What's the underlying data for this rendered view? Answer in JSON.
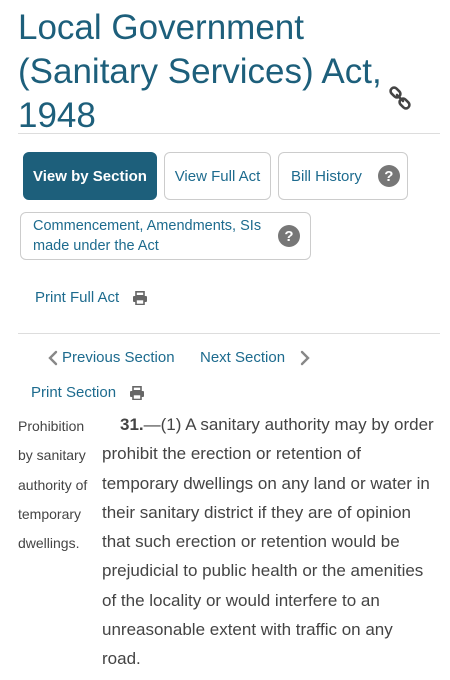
{
  "title_lines": [
    "Local Government",
    "(Sanitary Services) Act,",
    "1948"
  ],
  "buttons": {
    "view_by_section": "View by Section",
    "view_full_act": "View Full Act",
    "bill_history": "Bill History",
    "commencement_line1": "Commencement, Amendments, SIs",
    "commencement_line2": "made under the Act",
    "help_glyph": "?"
  },
  "print_full_act": "Print Full Act",
  "nav": {
    "previous": "Previous Section",
    "next": "Next Section"
  },
  "print_section": "Print Section",
  "section": {
    "margin_note_lines": [
      "Prohibition",
      "by sanitary",
      "authority of",
      "temporary",
      "dwellings."
    ],
    "number": "31.",
    "text_lines": [
      "—(1) A sanitary authority may by order",
      "prohibit the erection or retention of",
      "temporary dwellings on any land or water in",
      "their sanitary district if they are of opinion",
      "that such erection or retention would be",
      "prejudicial to public health or the amenities",
      "of the locality or would interfere to an",
      "unreasonable extent with traffic on any",
      "road."
    ]
  },
  "icons": {
    "permalink": "link-icon",
    "print": "printer-icon",
    "help": "question-circle-icon",
    "prev": "chevron-left-icon",
    "next": "chevron-right-icon"
  },
  "colors": {
    "primary": "#1d5f7b",
    "link": "#1d6b8e",
    "help_badge": "#777777"
  }
}
